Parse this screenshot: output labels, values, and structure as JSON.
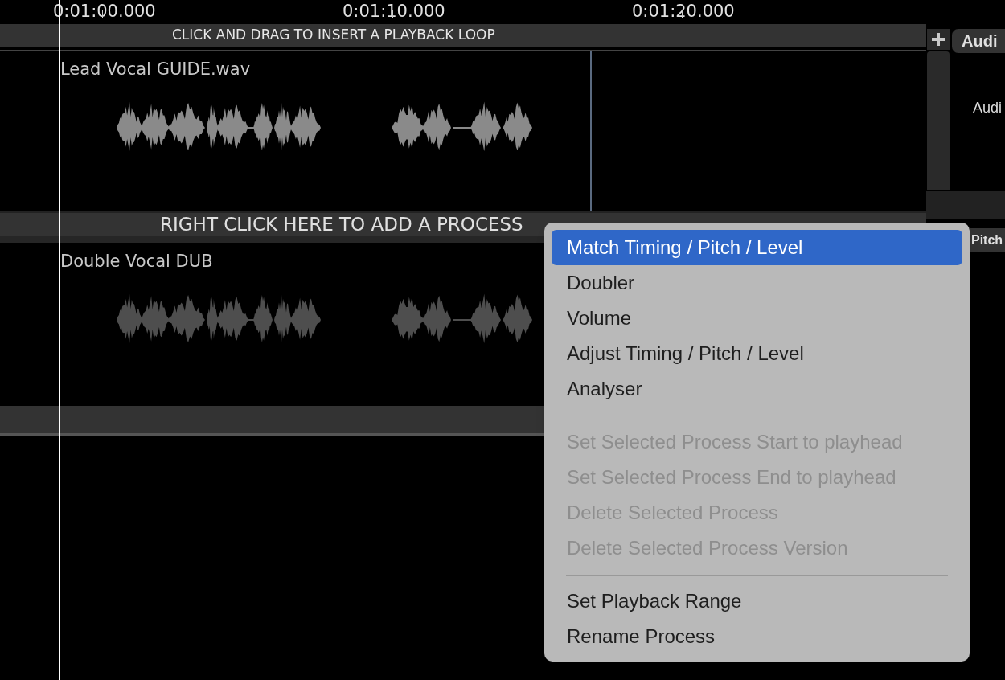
{
  "ruler": {
    "times": [
      "0:01:00.000",
      "0:01:10.000",
      "0:01:20.000"
    ]
  },
  "loop_bar": {
    "label": "CLICK AND DRAG TO INSERT A PLAYBACK LOOP"
  },
  "tracks": [
    {
      "name": "Lead Vocal GUIDE.wav",
      "kind": "guide"
    },
    {
      "name": "Double Vocal DUB",
      "kind": "dub"
    }
  ],
  "process_bar": {
    "label": "RIGHT CLICK HERE TO ADD A PROCESS"
  },
  "side_panel": {
    "tab": "Audi",
    "text": "Audi",
    "tab_2": "Pitch"
  },
  "context_menu": {
    "items": [
      {
        "kind": "item",
        "label": "Match Timing / Pitch / Level",
        "selected": true,
        "disabled": false
      },
      {
        "kind": "item",
        "label": "Doubler",
        "selected": false,
        "disabled": false
      },
      {
        "kind": "item",
        "label": "Volume",
        "selected": false,
        "disabled": false
      },
      {
        "kind": "item",
        "label": "Adjust Timing / Pitch / Level",
        "selected": false,
        "disabled": false
      },
      {
        "kind": "item",
        "label": "Analyser",
        "selected": false,
        "disabled": false
      },
      {
        "kind": "separator"
      },
      {
        "kind": "item",
        "label": "Set Selected Process Start to playhead",
        "selected": false,
        "disabled": true
      },
      {
        "kind": "item",
        "label": "Set Selected Process End to playhead",
        "selected": false,
        "disabled": true
      },
      {
        "kind": "item",
        "label": "Delete Selected Process",
        "selected": false,
        "disabled": true
      },
      {
        "kind": "item",
        "label": "Delete Selected Process Version",
        "selected": false,
        "disabled": true
      },
      {
        "kind": "separator"
      },
      {
        "kind": "item",
        "label": "Set Playback Range",
        "selected": false,
        "disabled": false
      },
      {
        "kind": "item",
        "label": "Rename Process",
        "selected": false,
        "disabled": false
      }
    ]
  }
}
